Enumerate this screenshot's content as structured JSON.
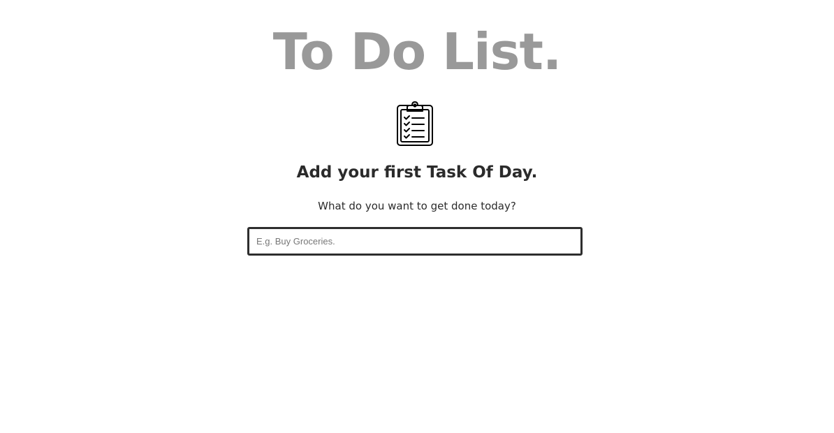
{
  "header": {
    "title": "To Do List."
  },
  "empty_state": {
    "icon": "clipboard-checklist-icon",
    "heading": "Add your first Task Of Day.",
    "subtext": "What do you want to get done today?"
  },
  "task_input": {
    "value": "",
    "placeholder": "E.g. Buy Groceries."
  },
  "colors": {
    "title": "#999999",
    "text": "#2b2b2b",
    "input_border": "#2e2e2e",
    "background": "#ffffff"
  }
}
